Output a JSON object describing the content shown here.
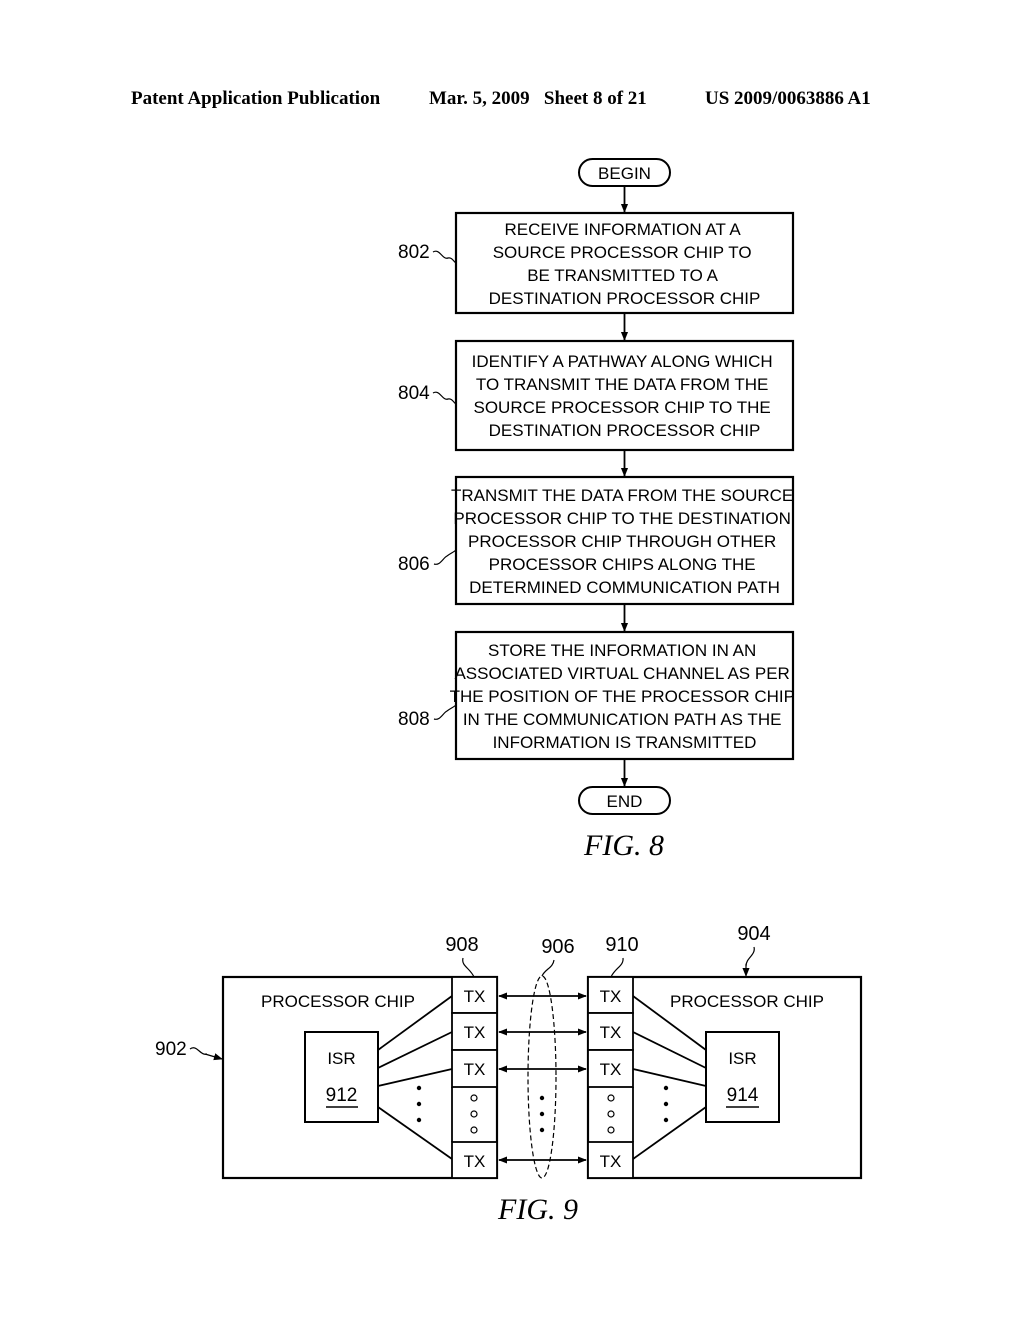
{
  "header": {
    "left": "Patent Application Publication",
    "middle": "Mar. 5, 2009   Sheet 8 of 21",
    "right": "US 2009/0063886 A1"
  },
  "fig8": {
    "caption": "FIG. 8",
    "begin_label": "BEGIN",
    "end_label": "END",
    "steps": [
      {
        "ref": "802",
        "lines": [
          "RECEIVE INFORMATION AT A",
          "SOURCE PROCESSOR CHIP TO",
          "BE TRANSMITTED TO A",
          "DESTINATION PROCESSOR CHIP"
        ]
      },
      {
        "ref": "804",
        "lines": [
          "IDENTIFY A PATHWAY ALONG WHICH",
          "TO TRANSMIT THE DATA FROM THE",
          "SOURCE PROCESSOR CHIP TO THE",
          "DESTINATION PROCESSOR CHIP"
        ]
      },
      {
        "ref": "806",
        "lines": [
          "TRANSMIT THE DATA FROM THE SOURCE",
          "PROCESSOR CHIP TO THE DESTINATION",
          "PROCESSOR CHIP THROUGH OTHER",
          "PROCESSOR CHIPS ALONG THE",
          "DETERMINED COMMUNICATION PATH"
        ]
      },
      {
        "ref": "808",
        "lines": [
          "STORE THE INFORMATION IN AN",
          "ASSOCIATED VIRTUAL CHANNEL AS PER",
          "THE POSITION OF THE PROCESSOR CHIP",
          "IN THE COMMUNICATION PATH AS THE",
          "INFORMATION IS TRANSMITTED"
        ]
      }
    ]
  },
  "fig9": {
    "caption": "FIG. 9",
    "left_chip": {
      "ref": "902",
      "label": "PROCESSOR CHIP",
      "isr_label": "ISR",
      "isr_ref": "912"
    },
    "right_chip": {
      "ref": "904",
      "label": "PROCESSOR CHIP",
      "isr_label": "ISR",
      "isr_ref": "914"
    },
    "left_tx_ref": "908",
    "right_tx_ref": "910",
    "link_ref": "906",
    "tx_label": "TX"
  }
}
